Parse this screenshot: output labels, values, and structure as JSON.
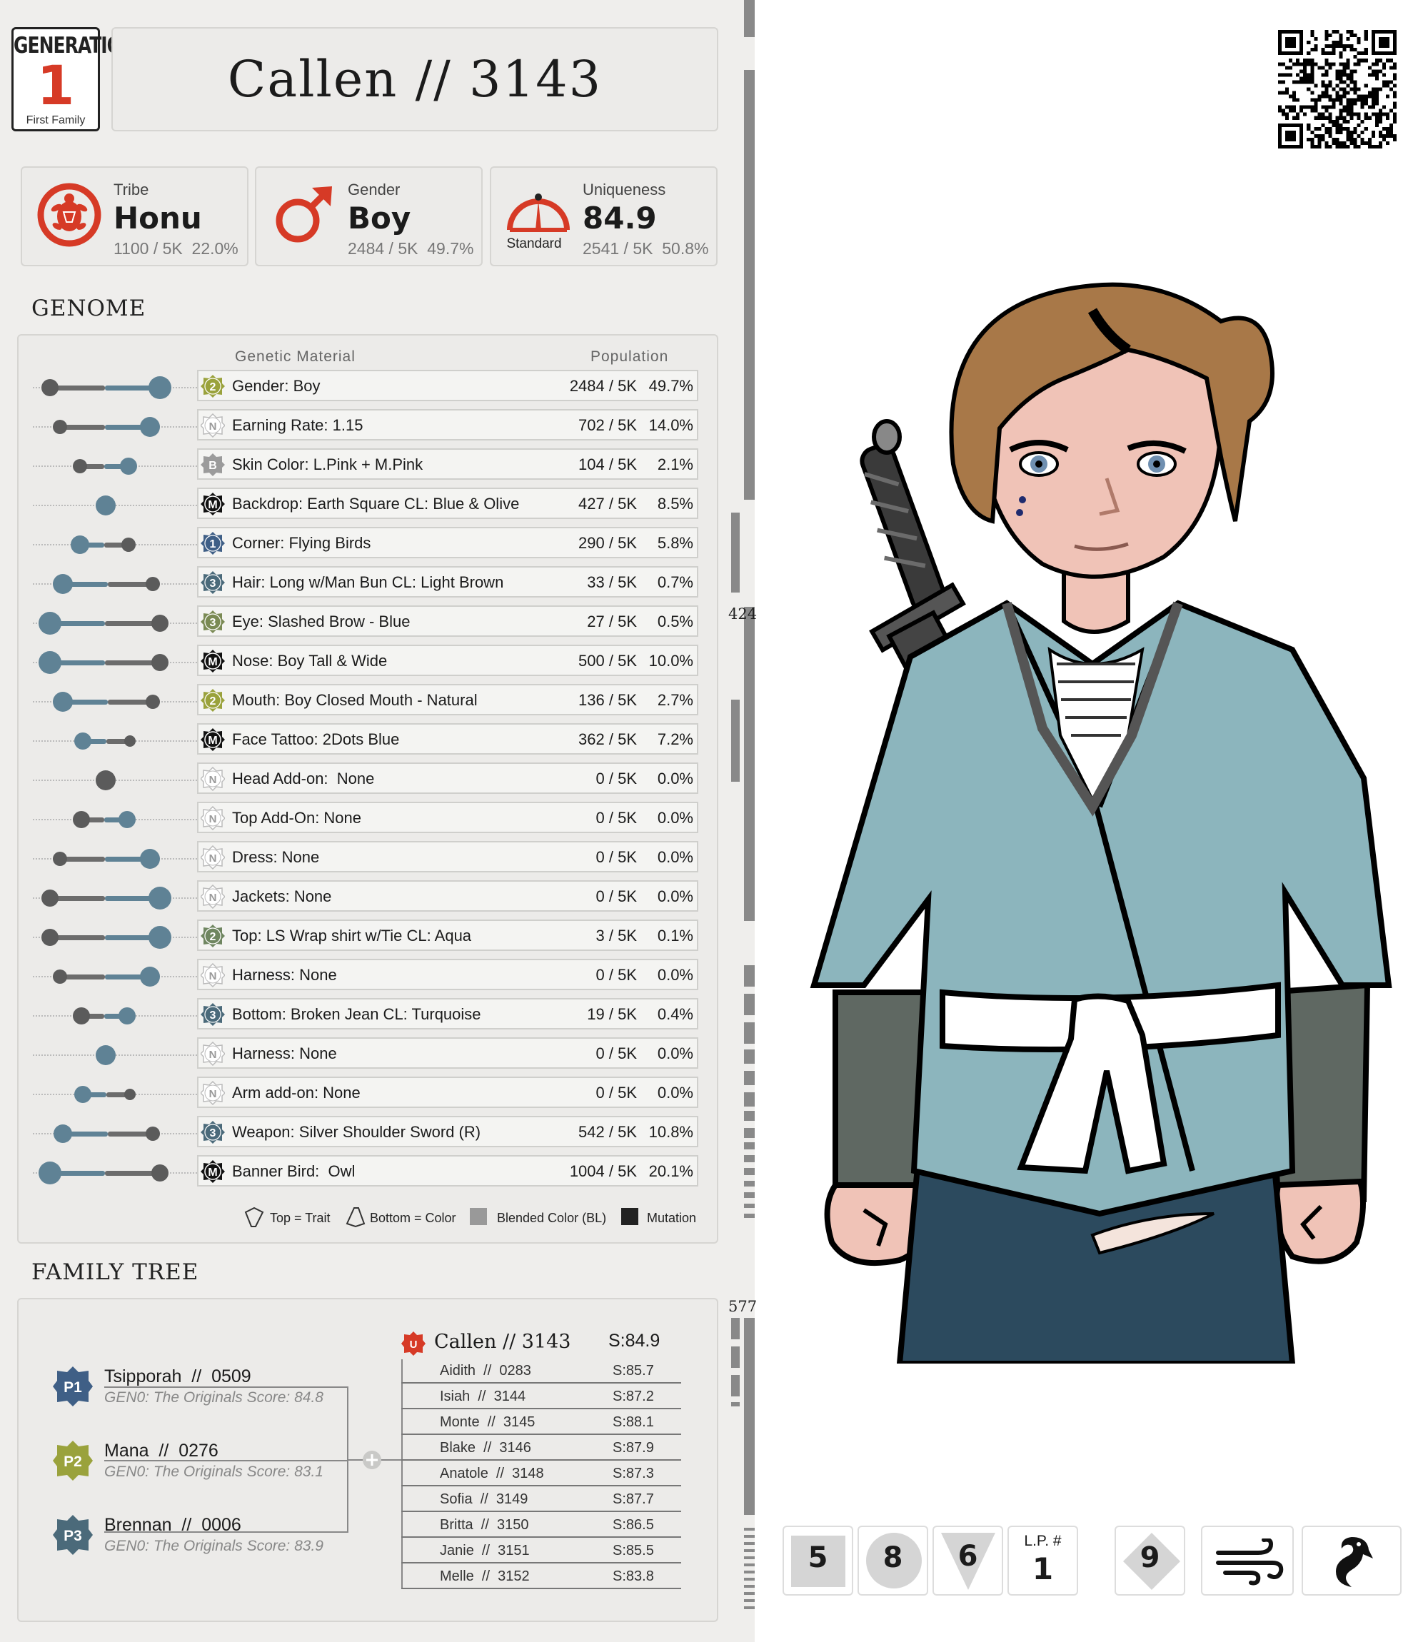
{
  "header": {
    "generation_label": "GENERATION",
    "generation_number": "1",
    "generation_sub": "First Family",
    "title": "Callen  //  3143"
  },
  "stats": [
    {
      "label": "Tribe",
      "value": "Honu",
      "count": "1100 / 5K  22.0%",
      "icon": "turtle-icon"
    },
    {
      "label": "Gender",
      "value": "Boy",
      "count": "2484 / 5K  49.7%",
      "icon": "male-symbol-icon"
    },
    {
      "label": "Uniqueness",
      "value": "84.9",
      "count": "2541 / 5K  50.8%",
      "icon": "gauge-icon",
      "gauge_label": "Standard"
    }
  ],
  "genome": {
    "title": "GENOME",
    "col_material": "Genetic Material",
    "col_population": "Population",
    "rows": [
      {
        "badge": "2",
        "badge_type": "num-olive",
        "name": "Gender: Boy",
        "count": "2484 / 5K",
        "pct": "49.7%"
      },
      {
        "badge": "N",
        "badge_type": "none",
        "name": "Earning Rate: 1.15",
        "count": "702 / 5K",
        "pct": "14.0%"
      },
      {
        "badge": "B",
        "badge_type": "blend",
        "name": "Skin Color: L.Pink + M.Pink",
        "count": "104 / 5K",
        "pct": "2.1%"
      },
      {
        "badge": "M",
        "badge_type": "mutation",
        "name": "Backdrop: Earth Square CL: Blue & Olive",
        "count": "427 / 5K",
        "pct": "8.5%"
      },
      {
        "badge": "1",
        "badge_type": "num-blue",
        "name": "Corner: Flying Birds",
        "count": "290 / 5K",
        "pct": "5.8%"
      },
      {
        "badge": "3",
        "badge_type": "num-slate",
        "name": "Hair: Long w/Man Bun CL: Light Brown",
        "count": "33 / 5K",
        "pct": "0.7%"
      },
      {
        "badge": "3",
        "badge_type": "num-olive-slate",
        "name": "Eye: Slashed Brow - Blue",
        "count": "27 / 5K",
        "pct": "0.5%"
      },
      {
        "badge": "M",
        "badge_type": "mutation",
        "name": "Nose: Boy Tall & Wide",
        "count": "500 / 5K",
        "pct": "10.0%"
      },
      {
        "badge": "2",
        "badge_type": "num-olive",
        "name": "Mouth: Boy Closed Mouth - Natural",
        "count": "136 / 5K",
        "pct": "2.7%"
      },
      {
        "badge": "M",
        "badge_type": "mutation",
        "name": "Face Tattoo: 2Dots Blue",
        "count": "362 / 5K",
        "pct": "7.2%"
      },
      {
        "badge": "N",
        "badge_type": "none",
        "name": "Head Add-on:  None",
        "count": "0 / 5K",
        "pct": "0.0%"
      },
      {
        "badge": "N",
        "badge_type": "none",
        "name": "Top Add-On: None",
        "count": "0 / 5K",
        "pct": "0.0%"
      },
      {
        "badge": "N",
        "badge_type": "none",
        "name": "Dress: None",
        "count": "0 / 5K",
        "pct": "0.0%"
      },
      {
        "badge": "N",
        "badge_type": "none",
        "name": "Jackets: None",
        "count": "0 / 5K",
        "pct": "0.0%"
      },
      {
        "badge": "2",
        "badge_type": "num-olive-blue",
        "name": "Top: LS Wrap shirt w/Tie CL: Aqua",
        "count": "3 / 5K",
        "pct": "0.1%"
      },
      {
        "badge": "N",
        "badge_type": "none",
        "name": "Harness: None",
        "count": "0 / 5K",
        "pct": "0.0%"
      },
      {
        "badge": "3",
        "badge_type": "num-slate",
        "name": "Bottom: Broken Jean CL: Turquoise",
        "count": "19 / 5K",
        "pct": "0.4%"
      },
      {
        "badge": "N",
        "badge_type": "none",
        "name": "Harness: None",
        "count": "0 / 5K",
        "pct": "0.0%"
      },
      {
        "badge": "N",
        "badge_type": "none",
        "name": "Arm add-on: None",
        "count": "0 / 5K",
        "pct": "0.0%"
      },
      {
        "badge": "3",
        "badge_type": "num-slate",
        "name": "Weapon: Silver Shoulder Sword (R)",
        "count": "542 / 5K",
        "pct": "10.8%"
      },
      {
        "badge": "M",
        "badge_type": "mutation",
        "name": "Banner Bird:  Owl",
        "count": "1004 / 5K",
        "pct": "20.1%"
      }
    ],
    "legend": {
      "top": "Top = Trait",
      "bottom": "Bottom = Color",
      "blend": "Blended Color (BL)",
      "mutation": "Mutation"
    }
  },
  "family_tree": {
    "title": "FAMILY TREE",
    "parents": [
      {
        "badge": "P1",
        "name": "Tsipporah  //  0509",
        "sub": "GEN0: The Originals Score: 84.8"
      },
      {
        "badge": "P2",
        "name": "Mana  //  0276",
        "sub": "GEN0: The Originals Score: 83.1"
      },
      {
        "badge": "P3",
        "name": "Brennan  //  0006",
        "sub": "GEN0: The Originals Score: 83.9"
      }
    ],
    "child": {
      "badge": "U",
      "name": "Callen // 3143",
      "score": "S:84.9"
    },
    "siblings": [
      {
        "name": "Aidith  //  0283",
        "score": "S:85.7"
      },
      {
        "name": "Isiah  //  3144",
        "score": "S:87.2"
      },
      {
        "name": "Monte  //  3145",
        "score": "S:88.1"
      },
      {
        "name": "Blake  //  3146",
        "score": "S:87.9"
      },
      {
        "name": "Anatole  //  3148",
        "score": "S:87.3"
      },
      {
        "name": "Sofia  //  3149",
        "score": "S:87.7"
      },
      {
        "name": "Britta  //  3150",
        "score": "S:86.5"
      },
      {
        "name": "Janie  //  3151",
        "score": "S:85.5"
      },
      {
        "name": "Melle  //  3152",
        "score": "S:83.8"
      }
    ]
  },
  "ruler_labels": [
    "424",
    "577"
  ],
  "tiles": [
    {
      "kind": "square",
      "value": "5"
    },
    {
      "kind": "circle",
      "value": "8"
    },
    {
      "kind": "triangle",
      "value": "6"
    },
    {
      "kind": "lp",
      "label": "L.P. #",
      "value": "1"
    },
    {
      "kind": "diamond",
      "value": "9"
    },
    {
      "kind": "icon",
      "icon": "wind-icon"
    },
    {
      "kind": "icon",
      "icon": "flamingo-icon"
    }
  ],
  "colors": {
    "accent_red": "#d63a26",
    "badge_olive": "#9aa23c",
    "badge_blue": "#3f5f86",
    "badge_slate": "#4b6a7a",
    "bar_blue": "#5f8295",
    "bar_grey": "#6c6c6c"
  }
}
